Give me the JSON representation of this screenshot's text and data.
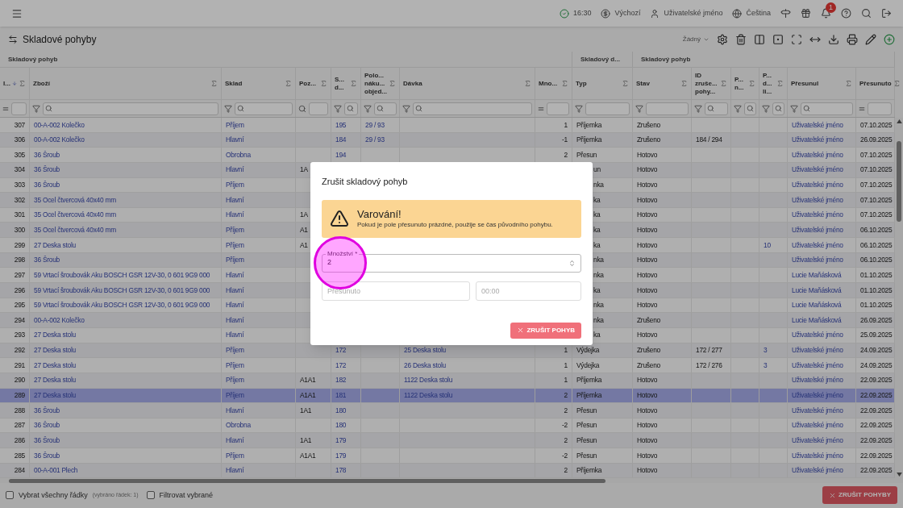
{
  "top_bar": {
    "time": "16:30",
    "currency": "Výchozí",
    "user": "Uživatelské jméno",
    "language": "Čeština",
    "notifications_badge": "1"
  },
  "page": {
    "title": "Skladové pohyby",
    "view_select": "Žádný"
  },
  "table": {
    "groups": [
      {
        "label": "Skladový pohyb"
      },
      {
        "label": "Skladový d..."
      },
      {
        "label": "Skladový pohyb"
      }
    ],
    "columns": [
      {
        "label": "I...",
        "kind": "id",
        "sorted": true
      },
      {
        "label": "Zboží",
        "kind": "link",
        "sorted": false
      },
      {
        "label": "Sklad",
        "kind": "link",
        "sorted": false
      },
      {
        "label": "Poz...",
        "kind": "position",
        "sorted": false
      },
      {
        "label": "S...\nd...",
        "kind": "link",
        "sorted": false
      },
      {
        "label": "Polo...\nnáku...\nobjed...",
        "kind": "link",
        "sorted": false
      },
      {
        "label": "Dávka",
        "kind": "link",
        "sorted": false
      },
      {
        "label": "Mno...",
        "kind": "number",
        "sorted": false
      },
      {
        "label": "Typ",
        "kind": "type",
        "sorted": false
      },
      {
        "label": "Stav",
        "kind": "status",
        "sorted": false
      },
      {
        "label": "ID\nzruše...\npohy...",
        "kind": "text",
        "sorted": false
      },
      {
        "label": "P...\nn...",
        "kind": "link",
        "sorted": false
      },
      {
        "label": "P...\nd...\nli...",
        "kind": "link",
        "sorted": false
      },
      {
        "label": "Přesunul",
        "kind": "link",
        "sorted": false
      },
      {
        "label": "Přesunuto",
        "kind": "date",
        "sorted": false
      }
    ],
    "rows": [
      {
        "cells": [
          "307",
          "00-A-002 Kolečko",
          "Příjem",
          "",
          "195",
          "29 / 93",
          "",
          "1",
          "Příjemka",
          "Zrušeno",
          "",
          "",
          "",
          "Uživatelské jméno",
          "07.10.2025"
        ],
        "selected": false,
        "under_dialog": false
      },
      {
        "cells": [
          "306",
          "00-A-002 Kolečko",
          "Hlavní",
          "",
          "184",
          "29 / 93",
          "",
          "-1",
          "Příjemka",
          "Zrušeno",
          "184 / 294",
          "",
          "",
          "Uživatelské jméno",
          "26.09.2025"
        ],
        "selected": false,
        "under_dialog": false
      },
      {
        "cells": [
          "305",
          "36 Šroub",
          "Obrobna",
          "",
          "194",
          "",
          "",
          "2",
          "Přesun",
          "Hotovo",
          "",
          "",
          "",
          "Uživatelské jméno",
          "07.10.2025"
        ],
        "selected": false,
        "under_dialog": false
      },
      {
        "cells": [
          "304",
          "36 Šroub",
          "Hlavní",
          "1A",
          "",
          "",
          "",
          "",
          "un",
          "Hotovo",
          "",
          "",
          "",
          "Uživatelské jméno",
          "07.10.2025"
        ],
        "selected": false,
        "under_dialog": true
      },
      {
        "cells": [
          "303",
          "36 Šroub",
          "Příjem",
          "",
          "",
          "",
          "",
          "",
          "nka",
          "Hotovo",
          "",
          "",
          "",
          "Uživatelské jméno",
          "07.10.2025"
        ],
        "selected": false,
        "under_dialog": true
      },
      {
        "cells": [
          "302",
          "35 Ocel čtvercová 40x40 mm",
          "Hlavní",
          "",
          "",
          "",
          "",
          "",
          "ka",
          "Hotovo",
          "",
          "",
          "",
          "Uživatelské jméno",
          "07.10.2025"
        ],
        "selected": false,
        "under_dialog": true
      },
      {
        "cells": [
          "301",
          "35 Ocel čtvercová 40x40 mm",
          "Hlavní",
          "1A",
          "",
          "",
          "",
          "",
          "ka",
          "Hotovo",
          "",
          "",
          "",
          "Uživatelské jméno",
          "07.10.2025"
        ],
        "selected": false,
        "under_dialog": true
      },
      {
        "cells": [
          "300",
          "35 Ocel čtvercová 40x40 mm",
          "Příjem",
          "A1",
          "",
          "",
          "",
          "",
          "ka",
          "Hotovo",
          "",
          "",
          "",
          "Uživatelské jméno",
          "06.10.2025"
        ],
        "selected": false,
        "under_dialog": true
      },
      {
        "cells": [
          "299",
          "27 Deska stolu",
          "Příjem",
          "A1",
          "",
          "",
          "",
          "",
          "ka",
          "Hotovo",
          "",
          "",
          "10",
          "Uživatelské jméno",
          "06.10.2025"
        ],
        "selected": false,
        "under_dialog": true
      },
      {
        "cells": [
          "298",
          "36 Šroub",
          "Příjem",
          "",
          "",
          "",
          "",
          "",
          "nka",
          "Hotovo",
          "",
          "",
          "",
          "Uživatelské jméno",
          "06.10.2025"
        ],
        "selected": false,
        "under_dialog": true
      },
      {
        "cells": [
          "297",
          "59 Vrtací šroubovák Aku BOSCH GSR 12V-30, 0 601 9G9 000",
          "Hlavní",
          "",
          "",
          "",
          "",
          "",
          "nka",
          "Hotovo",
          "",
          "",
          "",
          "Lucie Maňásková",
          "01.10.2025"
        ],
        "selected": false,
        "under_dialog": true
      },
      {
        "cells": [
          "296",
          "59 Vrtací šroubovák Aku BOSCH GSR 12V-30, 0 601 9G9 000",
          "Hlavní",
          "",
          "",
          "",
          "",
          "",
          "ka",
          "Hotovo",
          "",
          "",
          "",
          "Lucie Maňásková",
          "01.10.2025"
        ],
        "selected": false,
        "under_dialog": true
      },
      {
        "cells": [
          "295",
          "59 Vrtací šroubovák Aku BOSCH GSR 12V-30, 0 601 9G9 000",
          "Hlavní",
          "",
          "",
          "",
          "",
          "",
          "nka",
          "Hotovo",
          "",
          "",
          "",
          "Lucie Maňásková",
          "01.10.2025"
        ],
        "selected": false,
        "under_dialog": true
      },
      {
        "cells": [
          "294",
          "00-A-002 Kolečko",
          "Hlavní",
          "",
          "",
          "",
          "",
          "",
          "nka",
          "Zrušeno",
          "",
          "",
          "",
          "Lucie Maňásková",
          "26.09.2025"
        ],
        "selected": false,
        "under_dialog": true
      },
      {
        "cells": [
          "293",
          "27 Deska stolu",
          "Hlavní",
          "",
          "",
          "",
          "",
          "",
          "ka",
          "Hotovo",
          "",
          "",
          "",
          "Uživatelské jméno",
          "25.09.2025"
        ],
        "selected": false,
        "under_dialog": true
      },
      {
        "cells": [
          "292",
          "27 Deska stolu",
          "Příjem",
          "",
          "172",
          "",
          "25 Deska stolu",
          "1",
          "Výdejka",
          "Zrušeno",
          "172 / 277",
          "",
          "3",
          "Uživatelské jméno",
          "24.09.2025"
        ],
        "selected": false,
        "under_dialog": false
      },
      {
        "cells": [
          "291",
          "27 Deska stolu",
          "Příjem",
          "",
          "172",
          "",
          "26 Deska stolu",
          "1",
          "Výdejka",
          "Zrušeno",
          "172 / 276",
          "",
          "3",
          "Uživatelské jméno",
          "24.09.2025"
        ],
        "selected": false,
        "under_dialog": false
      },
      {
        "cells": [
          "290",
          "27 Deska stolu",
          "Příjem",
          "A1A1",
          "182",
          "",
          "1122 Deska stolu",
          "1",
          "Příjemka",
          "Hotovo",
          "",
          "",
          "",
          "Uživatelské jméno",
          "22.09.2025"
        ],
        "selected": false,
        "under_dialog": false
      },
      {
        "cells": [
          "289",
          "27 Deska stolu",
          "Příjem",
          "A1A1",
          "181",
          "",
          "1122 Deska stolu",
          "2",
          "Příjemka",
          "Hotovo",
          "",
          "",
          "",
          "Uživatelské jméno",
          "22.09.2025"
        ],
        "selected": true,
        "under_dialog": false
      },
      {
        "cells": [
          "288",
          "36 Šroub",
          "Hlavní",
          "1A1",
          "180",
          "",
          "",
          "2",
          "Přesun",
          "Hotovo",
          "",
          "",
          "",
          "Uživatelské jméno",
          "22.09.2025"
        ],
        "selected": false,
        "under_dialog": false
      },
      {
        "cells": [
          "287",
          "36 Šroub",
          "Obrobna",
          "",
          "180",
          "",
          "",
          "-2",
          "Přesun",
          "Hotovo",
          "",
          "",
          "",
          "Uživatelské jméno",
          "22.09.2025"
        ],
        "selected": false,
        "under_dialog": false
      },
      {
        "cells": [
          "286",
          "36 Šroub",
          "Hlavní",
          "1A1",
          "179",
          "",
          "",
          "2",
          "Přesun",
          "Hotovo",
          "",
          "",
          "",
          "Uživatelské jméno",
          "22.09.2025"
        ],
        "selected": false,
        "under_dialog": false
      },
      {
        "cells": [
          "285",
          "36 Šroub",
          "Příjem",
          "A1A1",
          "179",
          "",
          "",
          "-2",
          "Přesun",
          "Hotovo",
          "",
          "",
          "",
          "Uživatelské jméno",
          "22.09.2025"
        ],
        "selected": false,
        "under_dialog": false
      },
      {
        "cells": [
          "284",
          "00-A-001 Plech",
          "Hlavní",
          "",
          "178",
          "",
          "",
          "2",
          "Příjemka",
          "Hotovo",
          "",
          "",
          "",
          "Uživatelské jméno",
          "22.09.2025"
        ],
        "selected": false,
        "under_dialog": false
      }
    ]
  },
  "footer": {
    "select_all": {
      "label": "Vybrat všechny řádky",
      "note": "(vybráno řádek: 1)",
      "checked": false
    },
    "filter_selected": {
      "label": "Filtrovat vybrané",
      "checked": false
    },
    "button": "ZRUŠIT POHYBY"
  },
  "dialog": {
    "title": "Zrušit skladový pohyb",
    "warning": {
      "title": "Varování!",
      "text": "Pokud je pole přesunuto prázdné, použije se čas původního pohybu."
    },
    "quantity": {
      "label": "Množství *",
      "value": "2"
    },
    "moved": {
      "placeholder": "Přesunuto"
    },
    "time": {
      "placeholder": "00:00"
    },
    "button": "ZRUŠIT POHYB"
  }
}
